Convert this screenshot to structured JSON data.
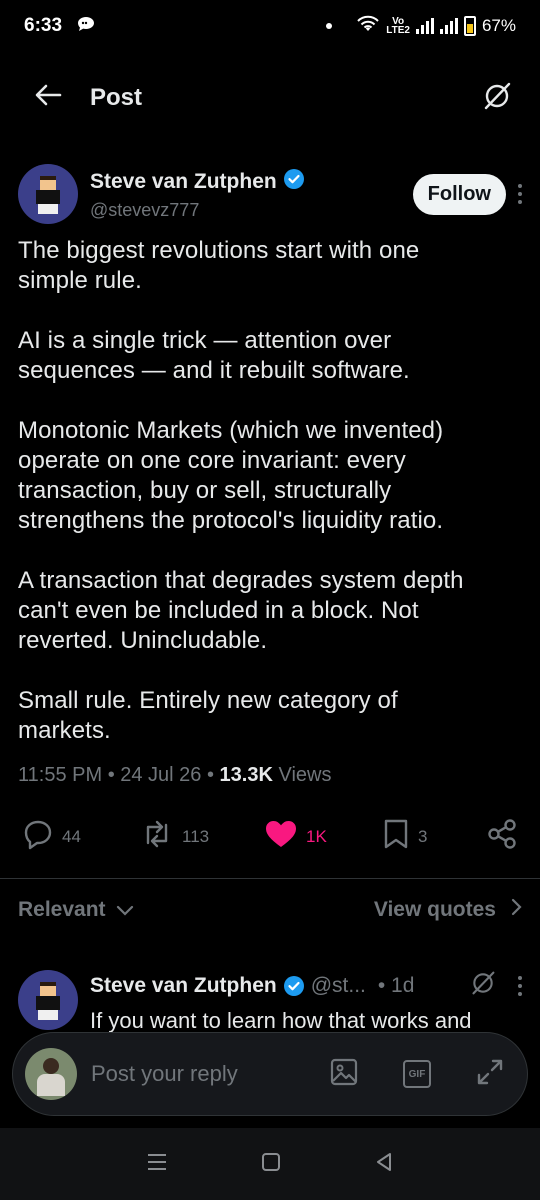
{
  "status": {
    "time": "6:33",
    "battery": "67%",
    "volte": "Vo\nLTE2"
  },
  "header": {
    "title": "Post"
  },
  "post": {
    "author_name": "Steve van Zutphen",
    "author_handle": "@stevevz777",
    "follow_label": "Follow",
    "text": "The biggest revolutions start with one\nsimple rule.\n\nAI is a single trick — attention over\nsequences — and it rebuilt software.\n\nMonotonic Markets (which we invented)\noperate on one core invariant: every\ntransaction, buy or sell, structurally\nstrengthens the protocol's liquidity ratio.\n\nA transaction that degrades system depth\ncan't even be included in a block. Not\nreverted. Unincludable.\n\nSmall rule. Entirely new category of\nmarkets.",
    "time": "11:55 PM",
    "date": "24 Jul 26",
    "views_count": "13.3K",
    "views_label": "Views",
    "replies": "44",
    "reposts": "113",
    "likes": "1K",
    "bookmarks": "3"
  },
  "sort": {
    "label": "Relevant",
    "view_quotes": "View quotes"
  },
  "reply": {
    "author_name": "Steve van Zutphen",
    "author_handle": "@st...",
    "age": "• 1d",
    "text": "If you want to learn how that works and"
  },
  "composer": {
    "placeholder": "Post your reply",
    "gif_label": "GIF"
  },
  "colors": {
    "accent": "#1d9bf0",
    "like": "#f91880",
    "muted": "#71767b"
  }
}
